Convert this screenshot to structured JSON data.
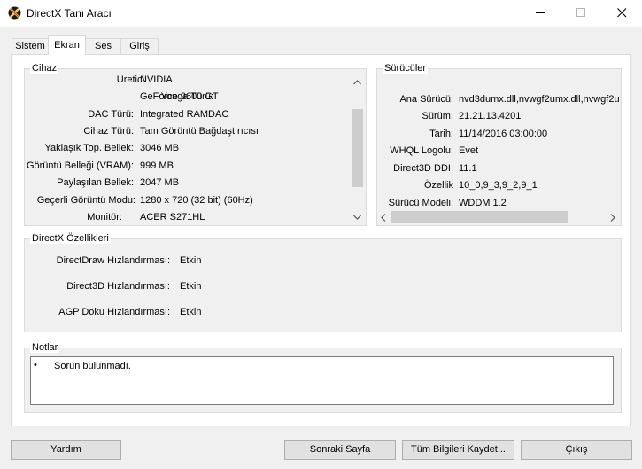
{
  "window": {
    "title": "DirectX Tanı Aracı"
  },
  "tabs": [
    {
      "label": "Sistem"
    },
    {
      "label": "Ekran"
    },
    {
      "label": "Ses"
    },
    {
      "label": "Giriş"
    }
  ],
  "device": {
    "title": "Cihaz",
    "rows": [
      {
        "label": "Uretici:",
        "value": "NVIDIA"
      },
      {
        "label": "Yonga Türü:",
        "value": "GeForce 9600 GT"
      },
      {
        "label": "DAC Türü:",
        "value": "Integrated RAMDAC"
      },
      {
        "label": "Cihaz Türü:",
        "value": "Tam Görüntü Bağdaştırıcısı"
      },
      {
        "label": "Yaklaşık Top. Bellek:",
        "value": "3046 MB"
      },
      {
        "label": "Görüntü Belleği (VRAM):",
        "value": "999 MB"
      },
      {
        "label": "Paylaşılan Bellek:",
        "value": "2047 MB"
      },
      {
        "label": "Geçerli Görüntü Modu:",
        "value": "1280 x 720 (32 bit) (60Hz)"
      },
      {
        "label": "Monitör:",
        "value": "ACER S271HL"
      }
    ]
  },
  "drivers": {
    "title": "Sürücüler",
    "rows": [
      {
        "label": "Ana Sürücü:",
        "value": "nvd3dumx.dll,nvwgf2umx.dll,nvwgf2u"
      },
      {
        "label": "Sürüm:",
        "value": "21.21.13.4201"
      },
      {
        "label": "Tarih:",
        "value": "11/14/2016 03:00:00"
      },
      {
        "label": "WHQL Logolu:",
        "value": "Evet"
      },
      {
        "label": "Direct3D DDI:",
        "value": "11.1"
      },
      {
        "label": "Özellik",
        "value": "10_0,9_3,9_2,9_1"
      },
      {
        "label": "Sürücü Modeli:",
        "value": "WDDM 1.2"
      }
    ]
  },
  "features": {
    "title": "DirectX Özellikleri",
    "rows": [
      {
        "label": "DirectDraw Hızlandırması:",
        "value": "Etkin"
      },
      {
        "label": "Direct3D Hızlandırması:",
        "value": "Etkin"
      },
      {
        "label": "AGP Doku Hızlandırması:",
        "value": "Etkin"
      }
    ]
  },
  "notes": {
    "title": "Notlar",
    "items": [
      "Sorun bulunmadı."
    ]
  },
  "buttons": {
    "help": "Yardım",
    "next_page": "Sonraki Sayfa",
    "save_all": "Tüm Bilgileri Kaydet...",
    "exit": "Çıkış"
  },
  "icons": {
    "app": "directx-icon",
    "minimize": "minimize-icon",
    "maximize": "maximize-icon",
    "close": "close-icon"
  }
}
